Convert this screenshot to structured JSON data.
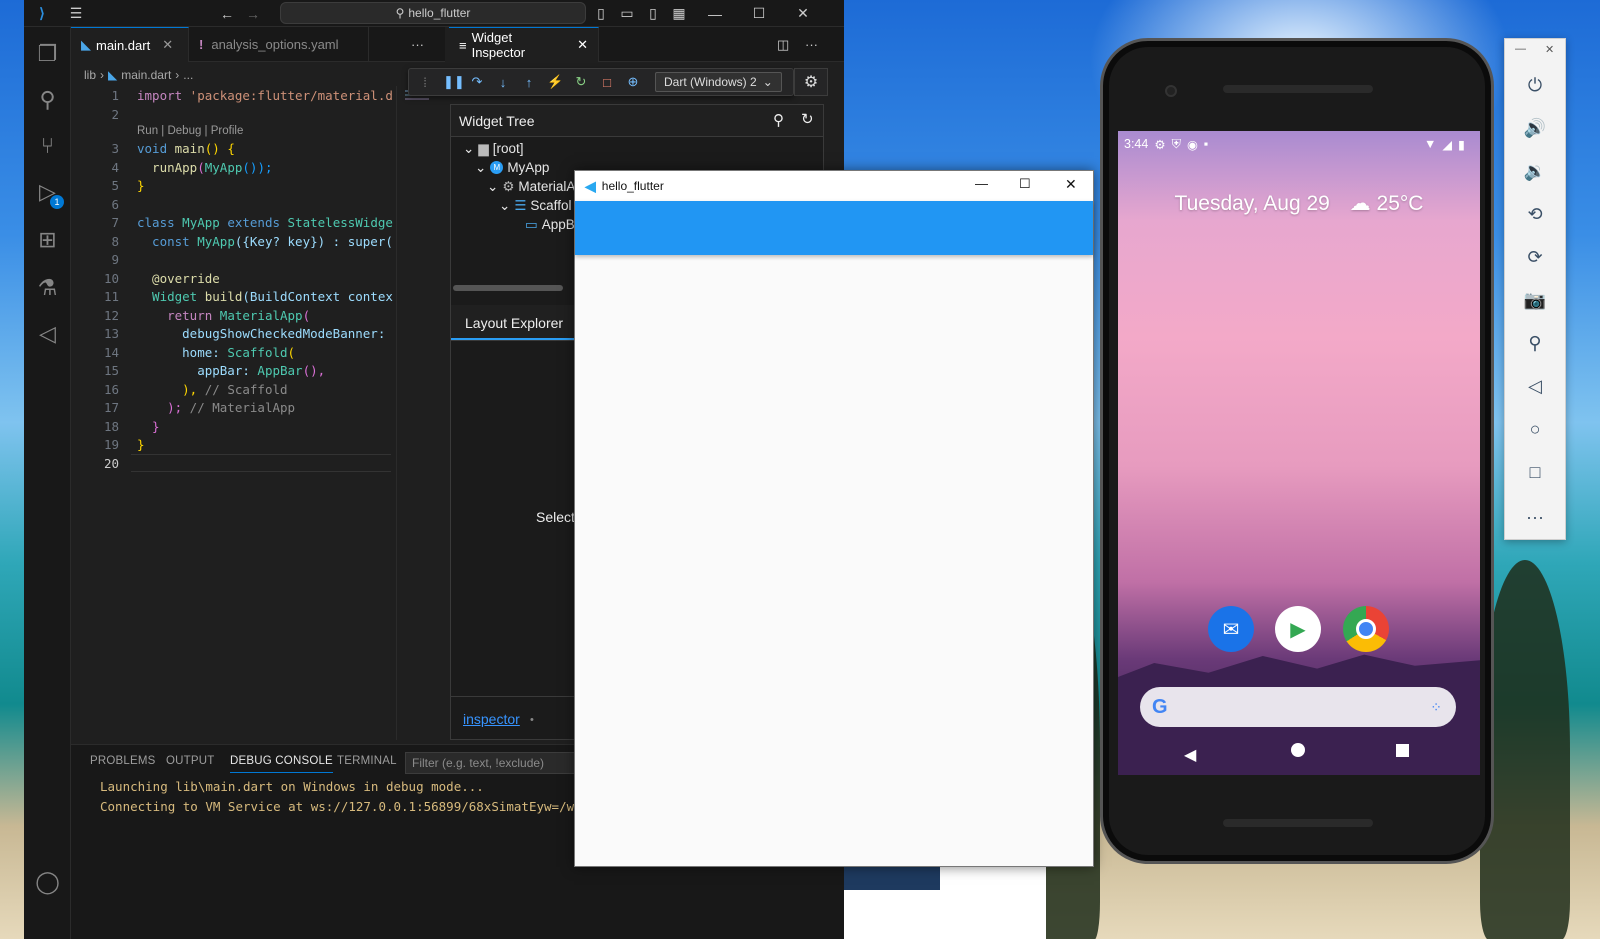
{
  "vscode": {
    "search_text": "hello_flutter",
    "editor_tabs": [
      {
        "label": "main.dart"
      },
      {
        "label": "analysis_options.yaml"
      }
    ],
    "breadcrumb": [
      "lib",
      "main.dart",
      "..."
    ],
    "codelens": "Run | Debug | Profile",
    "line_numbers": [
      "1",
      "2",
      "3",
      "4",
      "5",
      "6",
      "7",
      "8",
      "9",
      "10",
      "11",
      "12",
      "13",
      "14",
      "15",
      "16",
      "17",
      "18",
      "19",
      "20"
    ],
    "code": {
      "l1_kw": "import",
      "l1_str": " 'package:flutter/material.d",
      "l3_kw": "void",
      "l3_fn": " main",
      "l3_rest": "() {",
      "l4_fn": "  runApp",
      "l4_cls": "MyApp",
      "l4_rest": "());",
      "l5": "}",
      "l7_kw": "class",
      "l7_cls": " MyApp",
      "l7_kw2": " extends",
      "l7_cls2": " StatelessWidge",
      "l8_kw": "  const",
      "l8_cls": " MyApp",
      "l8_rest": "({Key? key}) : super(",
      "l10_ann": "  @override",
      "l11_cls": "  Widget",
      "l11_fn": " build",
      "l11_rest": "(BuildContext contex",
      "l12_kw": "    return",
      "l12_cls": " MaterialApp",
      "l12_rest": "(",
      "l13": "      debugShowCheckedModeBanner:",
      "l14_var": "      home:",
      "l14_cls": " Scaffold",
      "l14_rest": "(",
      "l15_var": "        appBar:",
      "l15_cls": " AppBar",
      "l15_rest": "(),",
      "l16_rest": "      ),",
      "l16_cmt": " // Scaffold",
      "l17_rest": "    );",
      "l17_cmt": " // MaterialApp",
      "l18": "  }",
      "l19": "}"
    },
    "inspector_tab": "Widget Inspector",
    "dart_select": "Dart (Windows) 2",
    "widget_tree_title": "Widget Tree",
    "tree": [
      {
        "label": "[root]"
      },
      {
        "label": "MyApp"
      },
      {
        "label": "MaterialA"
      },
      {
        "label": "Scaffol"
      },
      {
        "label": "AppB"
      }
    ],
    "layout_explorer_title": "Layout Explorer",
    "select_text": "Select",
    "inspector_link": "inspector",
    "panel_tabs": [
      "PROBLEMS",
      "OUTPUT",
      "DEBUG CONSOLE",
      "TERMINAL"
    ],
    "filter_placeholder": "Filter (e.g. text, !exclude)",
    "console_lines": [
      "Launching lib\\main.dart on Windows in debug mode...",
      "Connecting to VM Service at ws://127.0.0.1:56899/68xSimatEyw=/w"
    ],
    "debug_badge": "1"
  },
  "flutter_window": {
    "title": "hello_flutter",
    "appbar_color": "#2196f3"
  },
  "phone": {
    "time": "3:44",
    "date": "Tuesday, Aug 29",
    "temperature": "25°C"
  },
  "colors": {
    "accent": "#0078d4",
    "vscode_bg": "#1f1f1f"
  }
}
